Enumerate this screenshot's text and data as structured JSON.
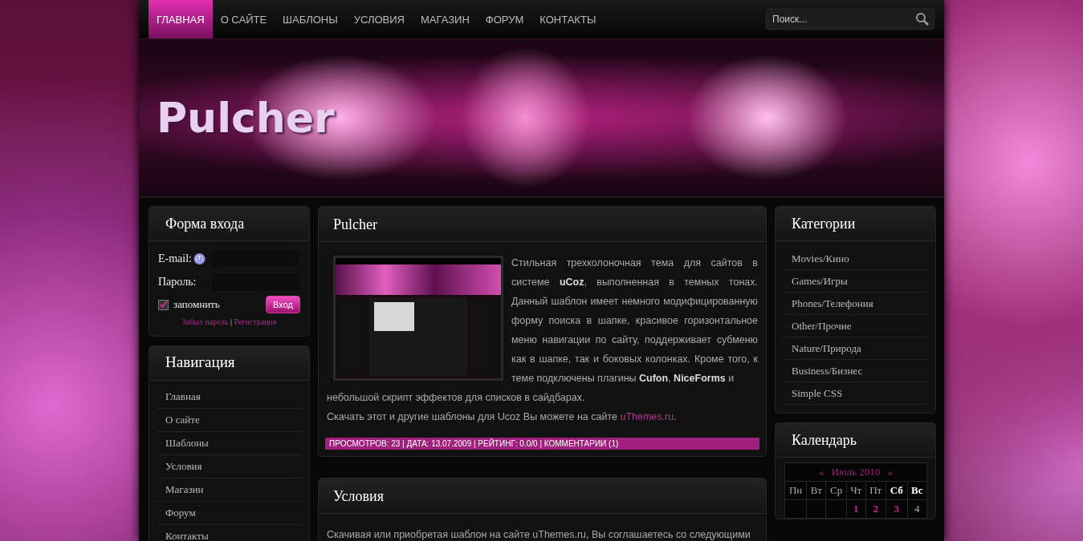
{
  "top_menu": [
    {
      "label": "ГЛАВНАЯ",
      "selected": true
    },
    {
      "label": "О САЙТЕ",
      "selected": false
    },
    {
      "label": "ШАБЛОНЫ",
      "selected": false
    },
    {
      "label": "УСЛОВИЯ",
      "selected": false
    },
    {
      "label": "МАГАЗИН",
      "selected": false
    },
    {
      "label": "ФОРУМ",
      "selected": false
    },
    {
      "label": "КОНТАКТЫ",
      "selected": false
    }
  ],
  "search": {
    "placeholder": "Поиск..."
  },
  "header": {
    "logo": "Pulcher"
  },
  "login": {
    "title": "Форма входа",
    "email_label": "E-mail:",
    "password_label": "Пароль:",
    "remember": {
      "label": "запомнить",
      "checked": true
    },
    "submit": "Вход",
    "forgot": "Забыл пароль",
    "separator": "|",
    "register": "Регистрация"
  },
  "navigation": {
    "title": "Навигация",
    "items": [
      "Главная",
      "О сайте",
      "Шаблоны",
      "Условия",
      "Магазин",
      "Форум",
      "Контакты"
    ]
  },
  "posts": [
    {
      "title": "Pulcher",
      "has_image": true,
      "intro": "Стильная трехколоночная тема для сайтов в системе **uCoz**, выполненная в темных тонах. Данный шаблон имеет немного модифицированную форму поиска в шапке, красивое горизонтальное меню навигации по сайту, поддерживает субменю как в шапке, так и боковых колонках. Кроме того, к теме подключены плагины **Cufon**, **NiceForms** и",
      "paragraphs": [
        {
          "text": "небольшой скрипт эффектов для списков в сайдбарах."
        },
        {
          "text": "Скачать этот и другие шаблоны для Ucoz Вы можете на сайте ",
          "link": "uThemes.ru",
          "after": "."
        }
      ],
      "meta": "ПРОСМОТРОВ: 23 | ДАТА: 13.07.2009 | РЕЙТИНГ: 0.0/0 | КОММЕНТАРИИ (1)"
    },
    {
      "title": "Условия",
      "has_image": false,
      "paragraphs": [
        {
          "text": "Скачивая или приобретая шаблон на сайте uThemes.ru, Вы соглашаетесь со следующими"
        }
      ]
    }
  ],
  "categories": {
    "title": "Категории",
    "items": [
      "Movies/Кино",
      "Games/Игры",
      "Phones/Телефония",
      "Other/Прочие",
      "Nature/Природа",
      "Business/Бизнес",
      "Simple CSS"
    ]
  },
  "calendar": {
    "title": "Календарь",
    "prev": "«",
    "month": "Июль 2010",
    "next": "»",
    "weekdays": [
      {
        "label": "Пн",
        "weekend": false
      },
      {
        "label": "Вт",
        "weekend": false
      },
      {
        "label": "Ср",
        "weekend": false
      },
      {
        "label": "Чт",
        "weekend": false
      },
      {
        "label": "Пт",
        "weekend": false
      },
      {
        "label": "Сб",
        "weekend": true
      },
      {
        "label": "Вс",
        "weekend": true
      }
    ],
    "weeks": [
      [
        {
          "kind": "blank"
        },
        {
          "kind": "blank"
        },
        {
          "kind": "blank"
        },
        {
          "kind": "day",
          "day": "1",
          "linked": true
        },
        {
          "kind": "day",
          "day": "2",
          "linked": true
        },
        {
          "kind": "day",
          "day": "3",
          "linked": true
        },
        {
          "kind": "day",
          "day": "4",
          "linked": false
        }
      ]
    ]
  }
}
